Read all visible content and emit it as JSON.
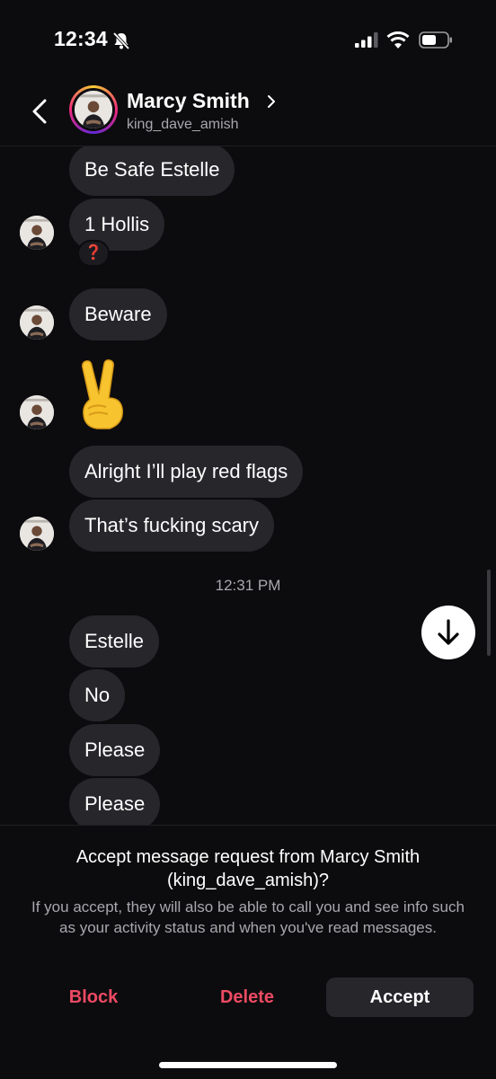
{
  "status_bar": {
    "time": "12:34"
  },
  "header": {
    "name": "Marcy Smith",
    "username": "king_dave_amish"
  },
  "messages": [
    {
      "text": "Be Safe Estelle"
    },
    {
      "text": "1 Hollis",
      "reaction": "❓"
    },
    {
      "text": "Beware"
    },
    {
      "text": "✌️"
    },
    {
      "text": "Alright I’ll play red flags"
    },
    {
      "text": "That’s fucking scary"
    },
    {
      "text": "Estelle"
    },
    {
      "text": "No"
    },
    {
      "text": "Please"
    },
    {
      "text": "Please"
    }
  ],
  "timestamp": "12:31 PM",
  "request": {
    "title": "Accept message request from Marcy Smith (king_dave_amish)?",
    "description": "If you accept, they will also be able to call you and see info such as your activity status and when you've read messages.",
    "block_label": "Block",
    "delete_label": "Delete",
    "accept_label": "Accept"
  },
  "colors": {
    "background": "#0c0c0e",
    "bubble": "#26262b",
    "destructive": "#ed4a63",
    "secondary_text": "#a8a8ad"
  }
}
